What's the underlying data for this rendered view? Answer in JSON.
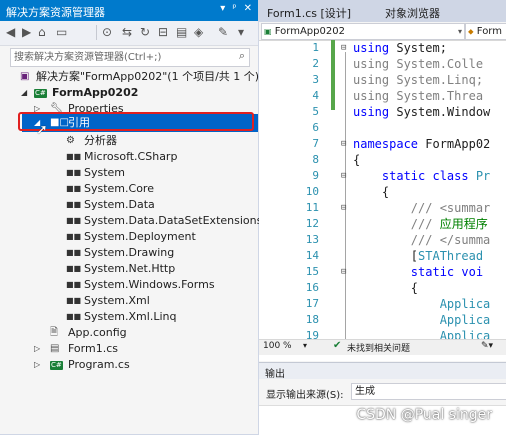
{
  "solution_explorer": {
    "title": "解决方案资源管理器",
    "title_buttons": [
      "▾",
      "ᵖ",
      "✕"
    ],
    "search_placeholder": "搜索解决方案资源管理器(Ctrl+;)",
    "tree": {
      "solution": "解决方案\"FormApp0202\"(1 个项目/共 1 个)",
      "project": "FormApp0202",
      "properties": "Properties",
      "references": "引用",
      "analyzers": "分析器",
      "reference_items": [
        "Microsoft.CSharp",
        "System",
        "System.Core",
        "System.Data",
        "System.Data.DataSetExtensions",
        "System.Deployment",
        "System.Drawing",
        "System.Net.Http",
        "System.Windows.Forms",
        "System.Xml",
        "System.Xml.Linq"
      ],
      "app_config": "App.config",
      "form1": "Form1.cs",
      "program": "Program.cs"
    }
  },
  "editor": {
    "tabs": [
      "Form1.cs [设计]",
      "对象浏览器"
    ],
    "nav_left": "FormApp0202",
    "nav_right": "Form",
    "lines": [
      {
        "n": "1",
        "parts": [
          [
            "kw",
            "using"
          ],
          [
            "typ",
            " System;"
          ]
        ]
      },
      {
        "n": "2",
        "parts": [
          [
            "gray",
            "using System.Colle"
          ]
        ]
      },
      {
        "n": "3",
        "parts": [
          [
            "gray",
            "using System.Linq;"
          ]
        ]
      },
      {
        "n": "4",
        "parts": [
          [
            "gray",
            "using System.Threa"
          ]
        ]
      },
      {
        "n": "5",
        "parts": [
          [
            "kw",
            "using"
          ],
          [
            "typ",
            " System.Window"
          ]
        ]
      },
      {
        "n": "6",
        "parts": []
      },
      {
        "n": "7",
        "parts": [
          [
            "kw",
            "namespace"
          ],
          [
            "typ",
            " FormApp02"
          ]
        ]
      },
      {
        "n": "8",
        "parts": [
          [
            "typ",
            "{"
          ]
        ]
      },
      {
        "n": "9",
        "parts": [
          [
            "typ",
            "    "
          ],
          [
            "kw",
            "static class"
          ],
          [
            "cyan",
            " Pr"
          ]
        ]
      },
      {
        "n": "10",
        "parts": [
          [
            "typ",
            "    {"
          ]
        ]
      },
      {
        "n": "11",
        "parts": [
          [
            "gray",
            "        /// "
          ],
          [
            "gray",
            "<summar"
          ]
        ]
      },
      {
        "n": "12",
        "parts": [
          [
            "gray",
            "        /// "
          ],
          [
            "green-cmt",
            "应用程序"
          ]
        ]
      },
      {
        "n": "13",
        "parts": [
          [
            "gray",
            "        /// </summa"
          ]
        ]
      },
      {
        "n": "14",
        "parts": [
          [
            "typ",
            "        ["
          ],
          [
            "cyan",
            "STAThread"
          ]
        ]
      },
      {
        "n": "15",
        "parts": [
          [
            "typ",
            "        "
          ],
          [
            "kw",
            "static voi"
          ]
        ]
      },
      {
        "n": "16",
        "parts": [
          [
            "typ",
            "        {"
          ]
        ]
      },
      {
        "n": "17",
        "parts": [
          [
            "typ",
            "            "
          ],
          [
            "cyan",
            "Applica"
          ]
        ]
      },
      {
        "n": "18",
        "parts": [
          [
            "typ",
            "            "
          ],
          [
            "cyan",
            "Applica"
          ]
        ]
      },
      {
        "n": "19",
        "parts": [
          [
            "typ",
            "            "
          ],
          [
            "cyan",
            "Applica"
          ]
        ]
      }
    ],
    "zoom": "100 %",
    "status": "未找到相关问题"
  },
  "output": {
    "title": "输出",
    "source_label": "显示输出来源(S):",
    "source_value": "生成"
  },
  "watermark": "CSDN @Pual singer"
}
